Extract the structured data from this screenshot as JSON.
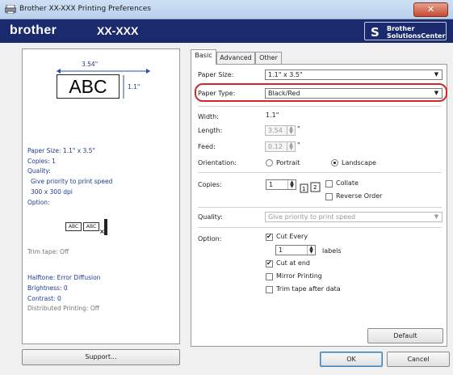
{
  "window": {
    "title": "Brother   XX-XXX Printing Preferences",
    "close_label": "✕"
  },
  "brand": {
    "logo": "brother",
    "model": "XX-XXX",
    "solutions_line1": "Brother",
    "solutions_line2": "SolutionsCenter"
  },
  "preview": {
    "width_dim": "3.54\"",
    "height_dim": "1.1\"",
    "sample_text": "ABC",
    "info": {
      "paper_size": "Paper Size: 1.1\" x 3.5\"",
      "copies": "Copies: 1",
      "quality_heading": "Quality:",
      "quality_value": "Give priority to print speed",
      "resolution": "300 x 300 dpi",
      "option_heading": "Option:",
      "trim_tape": "Trim tape: Off",
      "halftone": "Halftone: Error Diffusion",
      "brightness": "Brightness:  0",
      "contrast": "Contrast:  0",
      "distributed": "Distributed Printing: Off"
    },
    "small_sample_text": "ABC"
  },
  "support_button": "Support...",
  "tabs": [
    "Basic",
    "Advanced",
    "Other"
  ],
  "basic": {
    "paper_size_label": "Paper Size:",
    "paper_size_value": "1.1\" x 3.5\"",
    "paper_type_label": "Paper Type:",
    "paper_type_value": "Black/Red",
    "width_label": "Width:",
    "width_value": "1.1\"",
    "length_label": "Length:",
    "length_value": "3.54",
    "length_unit": "\"",
    "feed_label": "Feed:",
    "feed_value": "0.12",
    "feed_unit": "\"",
    "orientation_label": "Orientation:",
    "portrait_label": "Portrait",
    "landscape_label": "Landscape",
    "copies_label": "Copies:",
    "copies_value": "1",
    "collate_label": "Collate",
    "reverse_label": "Reverse Order",
    "quality_label": "Quality:",
    "quality_value": "Give priority to print speed",
    "option_label": "Option:",
    "cut_every_label": "Cut Every",
    "cut_every_value": "1",
    "labels_suffix": "labels",
    "cut_at_end_label": "Cut at end",
    "mirror_label": "Mirror Printing",
    "trim_after_label": "Trim tape after data",
    "default_button": "Default"
  },
  "ok_button": "OK",
  "cancel_button": "Cancel"
}
